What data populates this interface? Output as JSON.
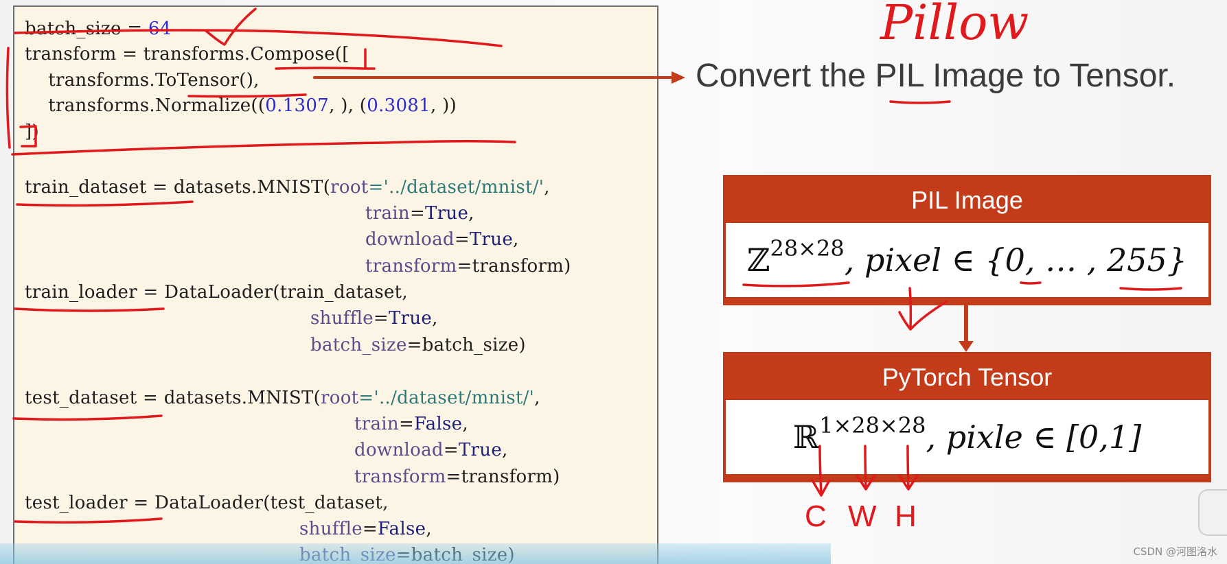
{
  "code": {
    "batch_size_name": "batch_size = ",
    "batch_size_value": "64",
    "transform_line": "transform = transforms.Compose([",
    "totensor_line": "    transforms.ToTensor(),",
    "normalize_pre": "    transforms.Normalize((",
    "normalize_mean": "0.1307",
    "normalize_mid": ", ), (",
    "normalize_std": "0.3081",
    "normalize_post": ", ))",
    "close_bracket": "])",
    "train_dataset_pre": "train_dataset = datasets.MNIST(",
    "root_kw": "root",
    "root_str": "='../dataset/mnist/'",
    "comma": ",",
    "train_kw": "train",
    "true_val": "True",
    "false_val": "False",
    "download_kw": "download",
    "transform_kw": "transform",
    "transform_val": "=transform)",
    "train_loader_pre": "train_loader = DataLoader(train_dataset,",
    "shuffle_kw": "shuffle",
    "batch_size_kw": "batch_size",
    "batch_size_val": "=batch_size)",
    "test_dataset_pre": "test_dataset = datasets.MNIST(",
    "test_loader_pre": "test_loader = DataLoader(test_dataset,",
    "eq": "="
  },
  "annotations": {
    "pillow": "Pillow",
    "convert": "Convert the PIL Image to Tensor.",
    "c": "C",
    "w": "W",
    "h": "H"
  },
  "diagram": {
    "pil_title": "PIL Image",
    "pil_set": "ℤ",
    "pil_sup": "28×28",
    "pil_rest": ", pixel ∈ {0, … , 255}",
    "tensor_title": "PyTorch Tensor",
    "tensor_set": "ℝ",
    "tensor_sup": "1×28×28",
    "tensor_rest": ", pixle ∈ [0,1]"
  },
  "watermark": "CSDN @河图洛水",
  "colors": {
    "ink": "#e0191c",
    "box": "#c43b1a",
    "code_bg": "#fcf5e6"
  }
}
